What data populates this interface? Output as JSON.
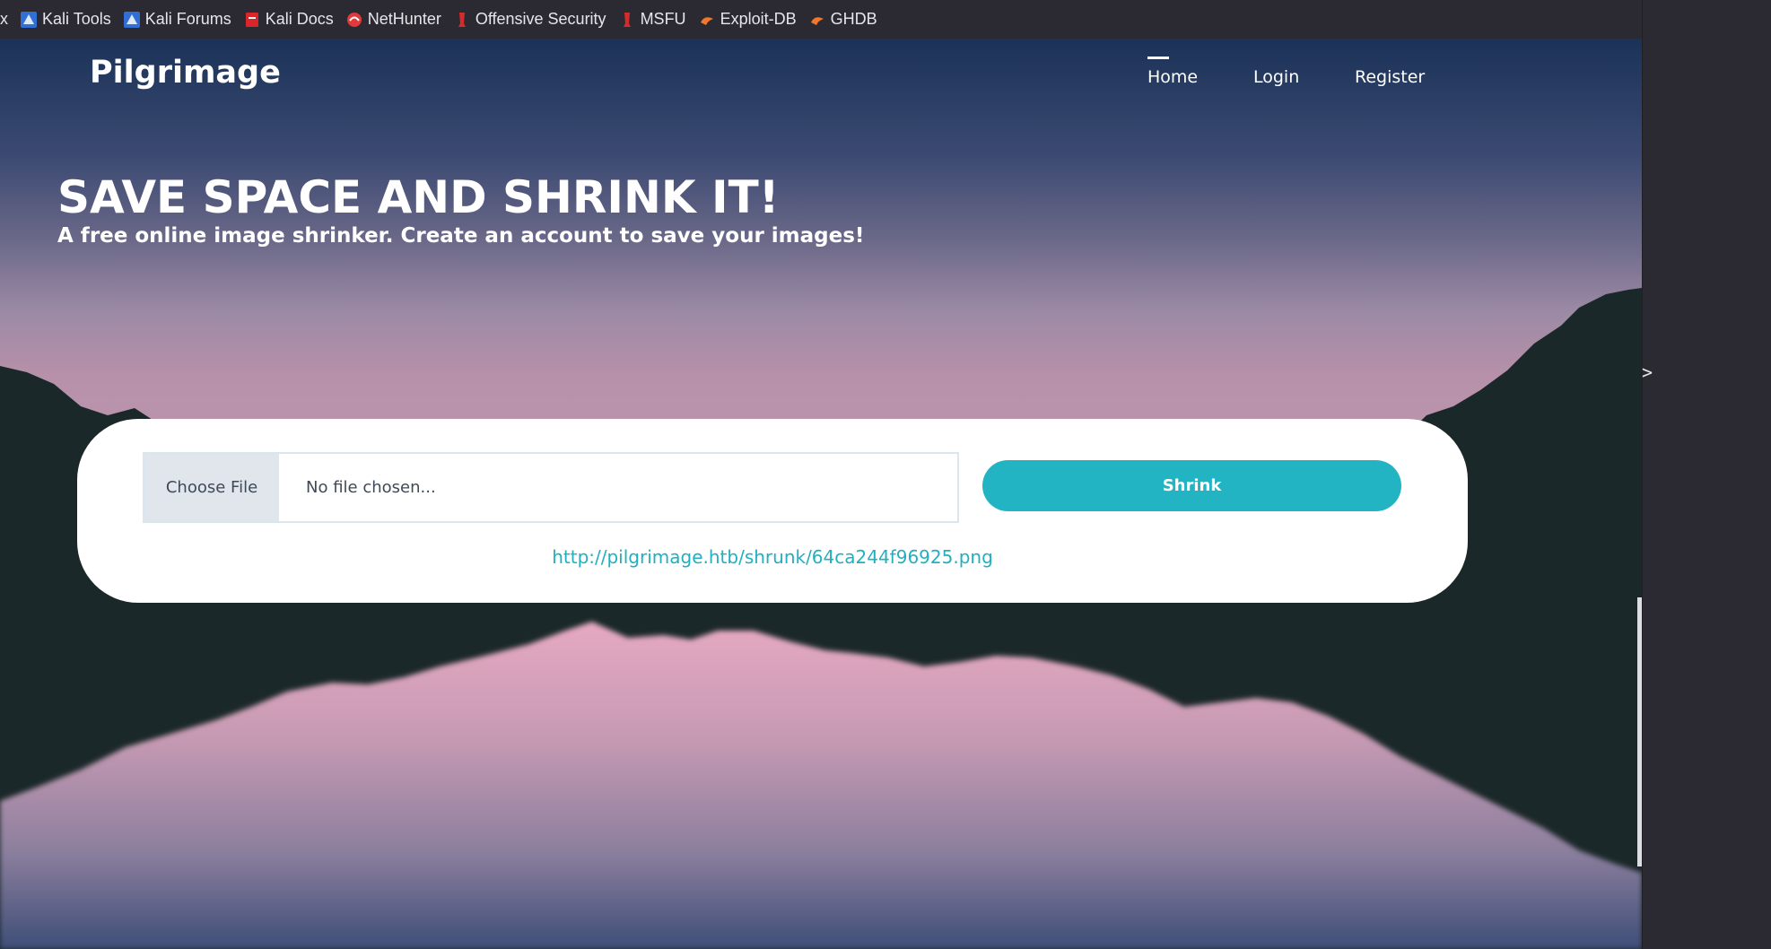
{
  "bookmarks": [
    {
      "label": "x",
      "icon": "close-fragment"
    },
    {
      "label": "Kali Tools",
      "icon": "kali-dragon-icon"
    },
    {
      "label": "Kali Forums",
      "icon": "kali-dragon-icon"
    },
    {
      "label": "Kali Docs",
      "icon": "kali-docs-icon"
    },
    {
      "label": "NetHunter",
      "icon": "nethunter-icon"
    },
    {
      "label": "Offensive Security",
      "icon": "offsec-icon"
    },
    {
      "label": "MSFU",
      "icon": "offsec-icon"
    },
    {
      "label": "Exploit-DB",
      "icon": "exploitdb-icon"
    },
    {
      "label": "GHDB",
      "icon": "exploitdb-icon"
    }
  ],
  "nav": {
    "brand": "Pilgrimage",
    "links": [
      "Home",
      "Login",
      "Register"
    ],
    "active": "Home"
  },
  "hero": {
    "title": "SAVE SPACE AND SHRINK IT!",
    "subtitle": "A free online image shrinker. Create an account to save your images!"
  },
  "upload": {
    "choose_label": "Choose File",
    "file_status": "No file chosen...",
    "shrink_label": "Shrink",
    "result_url": "http://pilgrimage.htb/shrunk/64ca244f96925.png"
  },
  "sidebar": {
    "toggle_glyph": ">"
  },
  "colors": {
    "accent": "#23b4c3",
    "link": "#22b0c0",
    "mountain": "#1b2829",
    "sky_pink": "#b992ab"
  }
}
